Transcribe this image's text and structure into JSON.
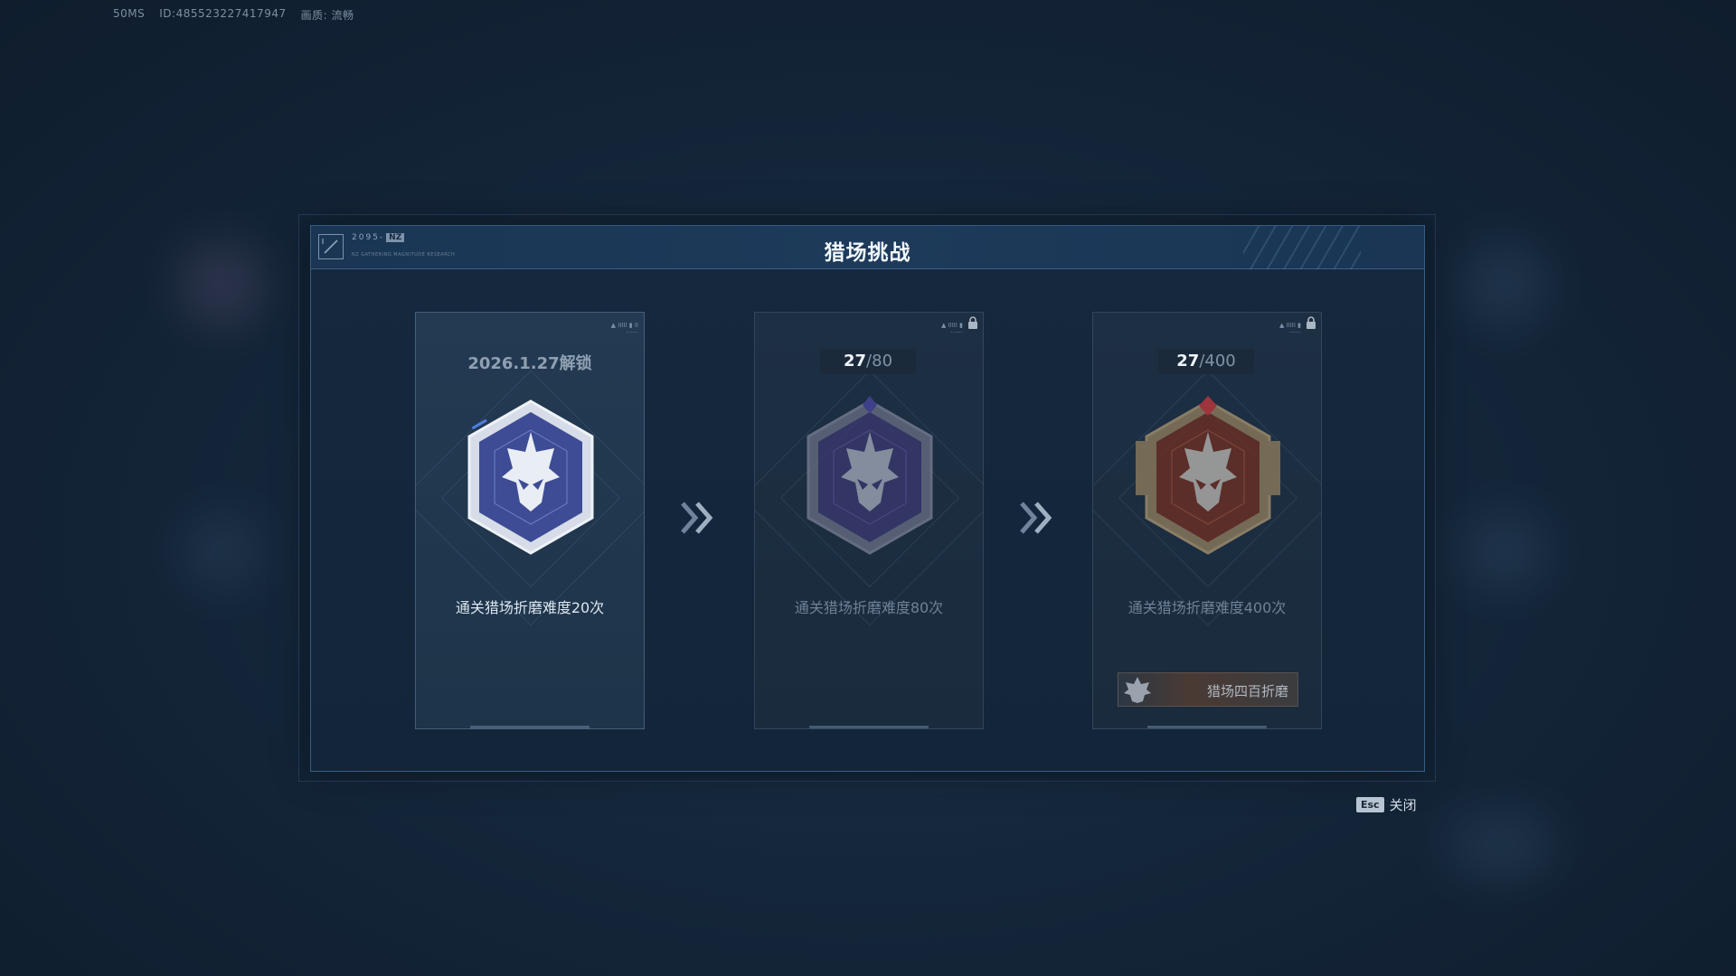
{
  "hud": {
    "ping": "50MS",
    "player_id": "ID:485523227417947",
    "quality": "画质: 流畅"
  },
  "header": {
    "title": "猎场挑战",
    "logo_text": "2095-",
    "logo_tag": "NZ",
    "logo_sub": "NZ GATHERING MAGNITUDE RESEARCH"
  },
  "cards": [
    {
      "status": "unlocked",
      "unlock_date": "2026.1.27解锁",
      "description": "通关猎场折磨难度20次",
      "tier_color": "#3f4f9a"
    },
    {
      "status": "locked",
      "progress_current": "27",
      "progress_total": "/80",
      "description": "通关猎场折磨难度80次",
      "tier_color": "#3b3870"
    },
    {
      "status": "locked",
      "progress_current": "27",
      "progress_total": "/400",
      "description": "通关猎场折磨难度400次",
      "reward_label": "猎场四百折磨",
      "tier_color": "#6b2f24"
    }
  ],
  "footer": {
    "esc_key": "Esc",
    "close_label": "关闭"
  }
}
